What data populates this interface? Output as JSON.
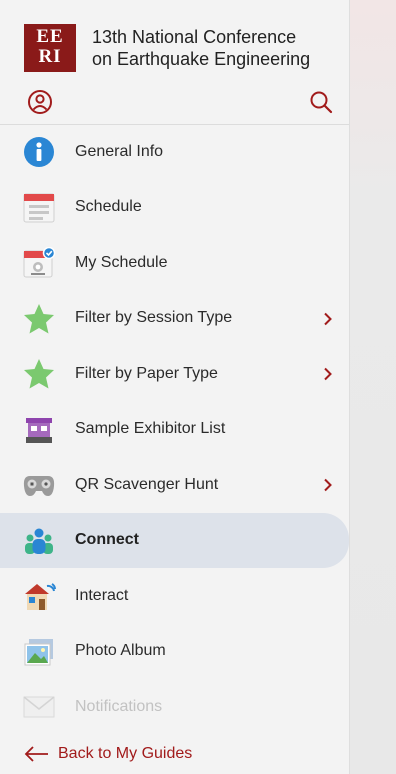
{
  "header": {
    "logo_line1": "EE",
    "logo_line2": "RI",
    "title_line1": "13th National Conference",
    "title_line2": "on Earthquake Engineering",
    "profile_icon": "profile-icon",
    "search_icon": "search-icon"
  },
  "menu": {
    "items": [
      {
        "label": "General Info",
        "icon": "info-icon"
      },
      {
        "label": "Schedule",
        "icon": "calendar-icon"
      },
      {
        "label": "My Schedule",
        "icon": "my-schedule-icon"
      },
      {
        "label": "Filter by Session Type",
        "icon": "star-icon",
        "has_submenu": true
      },
      {
        "label": "Filter by Paper Type",
        "icon": "star-icon",
        "has_submenu": true
      },
      {
        "label": "Sample Exhibitor List",
        "icon": "exhibitor-booth-icon"
      },
      {
        "label": "QR Scavenger Hunt",
        "icon": "gamepad-icon",
        "has_submenu": true
      },
      {
        "label": "Connect",
        "icon": "people-icon",
        "active": true
      },
      {
        "label": "Interact",
        "icon": "interact-icon"
      },
      {
        "label": "Photo Album",
        "icon": "photo-icon"
      },
      {
        "label": "Notifications",
        "icon": "envelope-icon",
        "disabled": true
      }
    ]
  },
  "footer": {
    "back_label": "Back to My Guides"
  },
  "colors": {
    "brand_red": "#8a1a19",
    "link_red": "#a11b1b",
    "active_bg": "#dde2ea",
    "info_blue": "#2a86d4",
    "star_green": "#7bc96f"
  }
}
